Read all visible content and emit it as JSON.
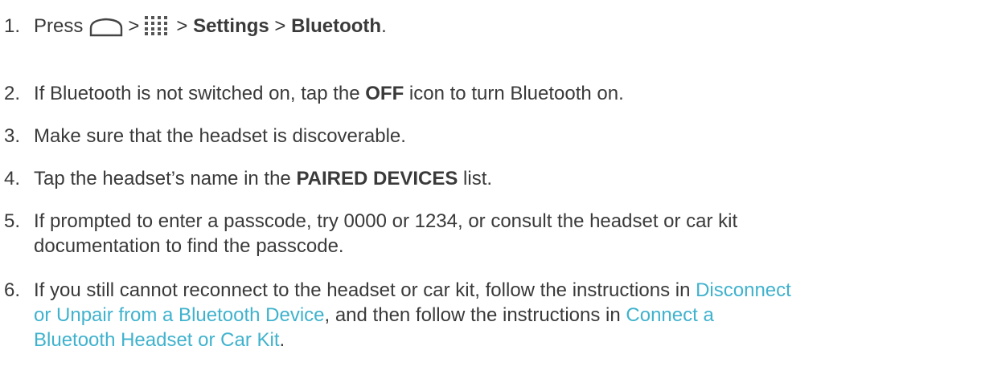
{
  "steps": [
    {
      "number": "1.",
      "press": "Press",
      "sep1": ">",
      "sep2": ">",
      "settings": "Settings",
      "sep3": ">",
      "bluetooth": "Bluetooth",
      "end": ".",
      "icons": [
        "home-icon",
        "apps-icon"
      ]
    },
    {
      "number": "2.",
      "before": "If Bluetooth is not switched on, tap the ",
      "bold": "OFF",
      "after": " icon to turn Bluetooth on."
    },
    {
      "number": "3.",
      "text": "Make sure that the headset is discoverable."
    },
    {
      "number": "4.",
      "before": "Tap the headset’s name in the ",
      "bold": "PAIRED DEVICES",
      "after": " list."
    },
    {
      "number": "5.",
      "line1": "If prompted to enter a passcode, try 0000 or 1234, or consult the headset or car kit",
      "line2": "documentation to find the passcode."
    },
    {
      "number": "6.",
      "before": "If you still cannot reconnect to the headset or car kit, follow the instructions in ",
      "link1_a": "Disconnect",
      "link1_b": "or Unpair from a Bluetooth Device",
      "middle": ", and then follow the instructions in ",
      "link2_a": "Connect a",
      "link2_b": "Bluetooth Headset or Car Kit",
      "end": "."
    }
  ],
  "colors": {
    "text": "#3a3a3a",
    "link": "#3fb2cd"
  }
}
